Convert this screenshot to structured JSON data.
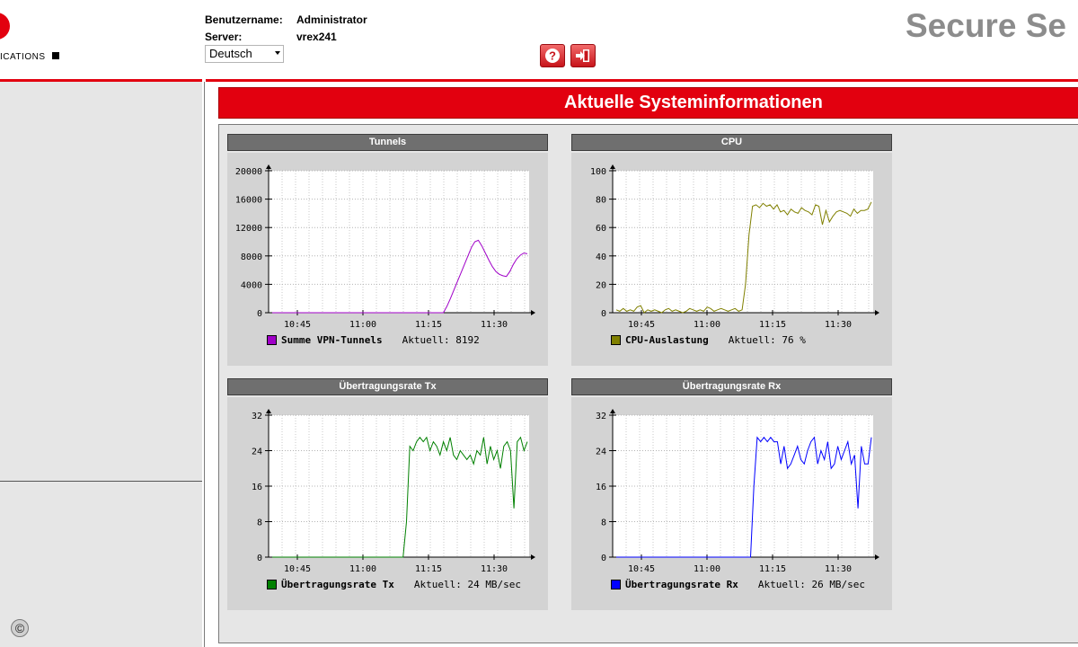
{
  "header": {
    "logo_text": "ICATIONS",
    "username_label": "Benutzername:",
    "username": "Administrator",
    "server_label": "Server:",
    "server": "vrex241",
    "language": "Deutsch",
    "brand_title": "Secure Se",
    "help_icon": "help-icon",
    "logout_icon": "logout-icon"
  },
  "sidebar": {
    "copyright": "©"
  },
  "main": {
    "title": "Aktuelle Systeminformationen"
  },
  "colors": {
    "accent": "#e2000f",
    "panel": "#e6e6e6",
    "plot": "#ffffff"
  },
  "charts": [
    {
      "title": "Tunnels",
      "legend": {
        "name": "Summe VPN-Tunnels",
        "current": "Aktuell: 8192",
        "color": "#a000c8"
      },
      "chart_data": {
        "type": "line",
        "x_ticks": [
          "10:45",
          "11:00",
          "11:15",
          "11:30"
        ],
        "y_ticks": [
          "20000",
          "16000",
          "12000",
          "8000",
          "4000",
          "0"
        ],
        "ylim": [
          0,
          20000
        ],
        "series": [
          {
            "name": "Summe VPN-Tunnels",
            "values": [
              0,
              0,
              0,
              0,
              0,
              0,
              0,
              0,
              0,
              0,
              0,
              0,
              0,
              0,
              0,
              0,
              0,
              0,
              0,
              0,
              0,
              0,
              0,
              0,
              0,
              0,
              0,
              0,
              0,
              0,
              0,
              0,
              0,
              0,
              0,
              0,
              0,
              0,
              0,
              0,
              0,
              0,
              0,
              0,
              0,
              0,
              0,
              0,
              0,
              0,
              900,
              2000,
              3200,
              4400,
              5600,
              6800,
              8000,
              9200,
              10000,
              10200,
              9400,
              8400,
              7400,
              6500,
              5800,
              5400,
              5200,
              5100,
              5800,
              6800,
              7600,
              8100,
              8400,
              8300
            ]
          }
        ]
      }
    },
    {
      "title": "CPU",
      "legend": {
        "name": "CPU-Auslastung",
        "current": "Aktuell: 76 %",
        "color": "#808000"
      },
      "chart_data": {
        "type": "line",
        "x_ticks": [
          "10:45",
          "11:00",
          "11:15",
          "11:30"
        ],
        "y_ticks": [
          "100",
          "80",
          "60",
          "40",
          "20",
          "0"
        ],
        "ylim": [
          0,
          100
        ],
        "series": [
          {
            "name": "CPU-Auslastung",
            "values": [
              2,
              1,
              3,
              1,
              2,
              1,
              4,
              5,
              0,
              2,
              1,
              2,
              1,
              0,
              2,
              3,
              1,
              2,
              1,
              0,
              1,
              3,
              2,
              1,
              2,
              1,
              4,
              3,
              1,
              2,
              3,
              2,
              1,
              2,
              3,
              1,
              2,
              20,
              55,
              75,
              76,
              74,
              77,
              75,
              76,
              73,
              76,
              71,
              72,
              69,
              73,
              71,
              70,
              74,
              72,
              71,
              69,
              76,
              75,
              62,
              72,
              64,
              68,
              71,
              72,
              71,
              70,
              68,
              73,
              70,
              72,
              72,
              73,
              78
            ]
          }
        ]
      }
    },
    {
      "title": "Übertragungsrate Tx",
      "legend": {
        "name": "Übertragungsrate Tx",
        "current": "Aktuell: 24 MB/sec",
        "color": "#008000"
      },
      "chart_data": {
        "type": "line",
        "x_ticks": [
          "10:45",
          "11:00",
          "11:15",
          "11:30"
        ],
        "y_ticks": [
          "32",
          "24",
          "16",
          "8",
          "0"
        ],
        "ylim": [
          0,
          32
        ],
        "series": [
          {
            "name": "Übertragungsrate Tx",
            "values": [
              0,
              0,
              0,
              0,
              0,
              0,
              0,
              0,
              0,
              0,
              0,
              0,
              0,
              0,
              0,
              0,
              0,
              0,
              0,
              0,
              0,
              0,
              0,
              0,
              0,
              0,
              0,
              0,
              0,
              0,
              0,
              0,
              0,
              0,
              0,
              0,
              0,
              0,
              0,
              0,
              8,
              25,
              24,
              26,
              27,
              26,
              27,
              24,
              26,
              25,
              23,
              26,
              24,
              27,
              23,
              22,
              24,
              23,
              22,
              23,
              21,
              24,
              23,
              27,
              21,
              25,
              22,
              24,
              20,
              25,
              26,
              24,
              11,
              26,
              27,
              24,
              26
            ]
          }
        ]
      }
    },
    {
      "title": "Übertragungsrate Rx",
      "legend": {
        "name": "Übertragungsrate Rx",
        "current": "Aktuell: 26 MB/sec",
        "color": "#0000ff"
      },
      "chart_data": {
        "type": "line",
        "x_ticks": [
          "10:45",
          "11:00",
          "11:15",
          "11:30"
        ],
        "y_ticks": [
          "32",
          "24",
          "16",
          "8",
          "0"
        ],
        "ylim": [
          0,
          32
        ],
        "series": [
          {
            "name": "Übertragungsrate Rx",
            "values": [
              0,
              0,
              0,
              0,
              0,
              0,
              0,
              0,
              0,
              0,
              0,
              0,
              0,
              0,
              0,
              0,
              0,
              0,
              0,
              0,
              0,
              0,
              0,
              0,
              0,
              0,
              0,
              0,
              0,
              0,
              0,
              0,
              0,
              0,
              0,
              0,
              0,
              0,
              0,
              0,
              0,
              16,
              27,
              26,
              27,
              26,
              27,
              26,
              26,
              21,
              25,
              20,
              21,
              23,
              25,
              22,
              21,
              24,
              26,
              27,
              21,
              24,
              22,
              26,
              20,
              21,
              25,
              22,
              24,
              26,
              21,
              23,
              11,
              25,
              21,
              21,
              27
            ]
          }
        ]
      }
    }
  ]
}
